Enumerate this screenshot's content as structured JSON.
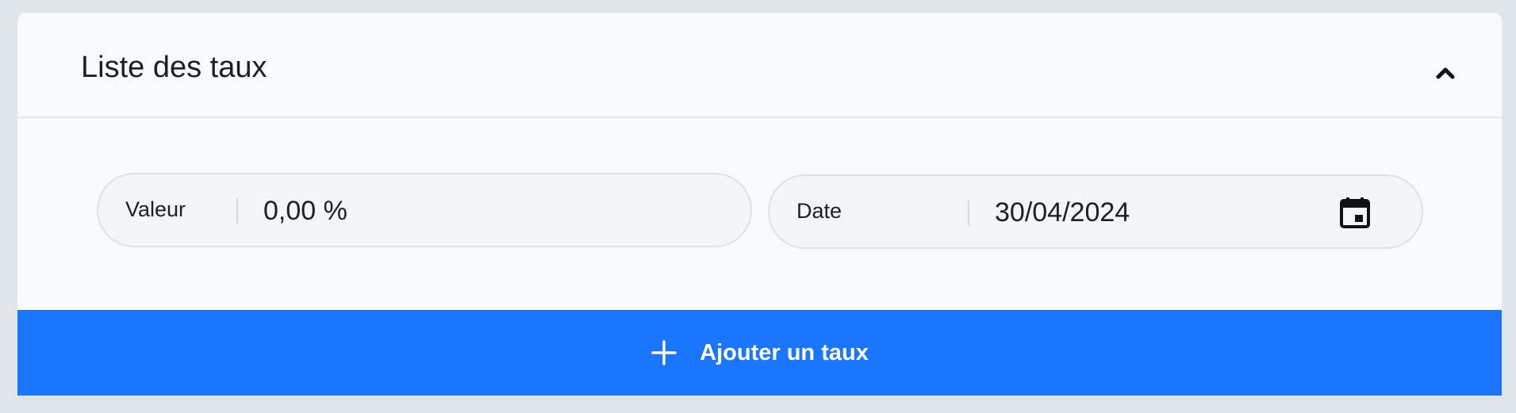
{
  "card": {
    "title": "Liste des taux",
    "collapse_icon": "chevron-up-icon"
  },
  "form": {
    "valeur": {
      "label": "Valeur",
      "value": "0,00 %"
    },
    "date": {
      "label": "Date",
      "value": "30/04/2024",
      "icon": "calendar-icon"
    }
  },
  "actions": {
    "add_label": "Ajouter un taux",
    "add_icon": "plus-icon"
  },
  "colors": {
    "primary": "#1a75ff",
    "page_background": "#dfe5e9",
    "card_background": "#f9fafc",
    "field_background": "#f3f5f6",
    "text": "#1c1f26"
  }
}
